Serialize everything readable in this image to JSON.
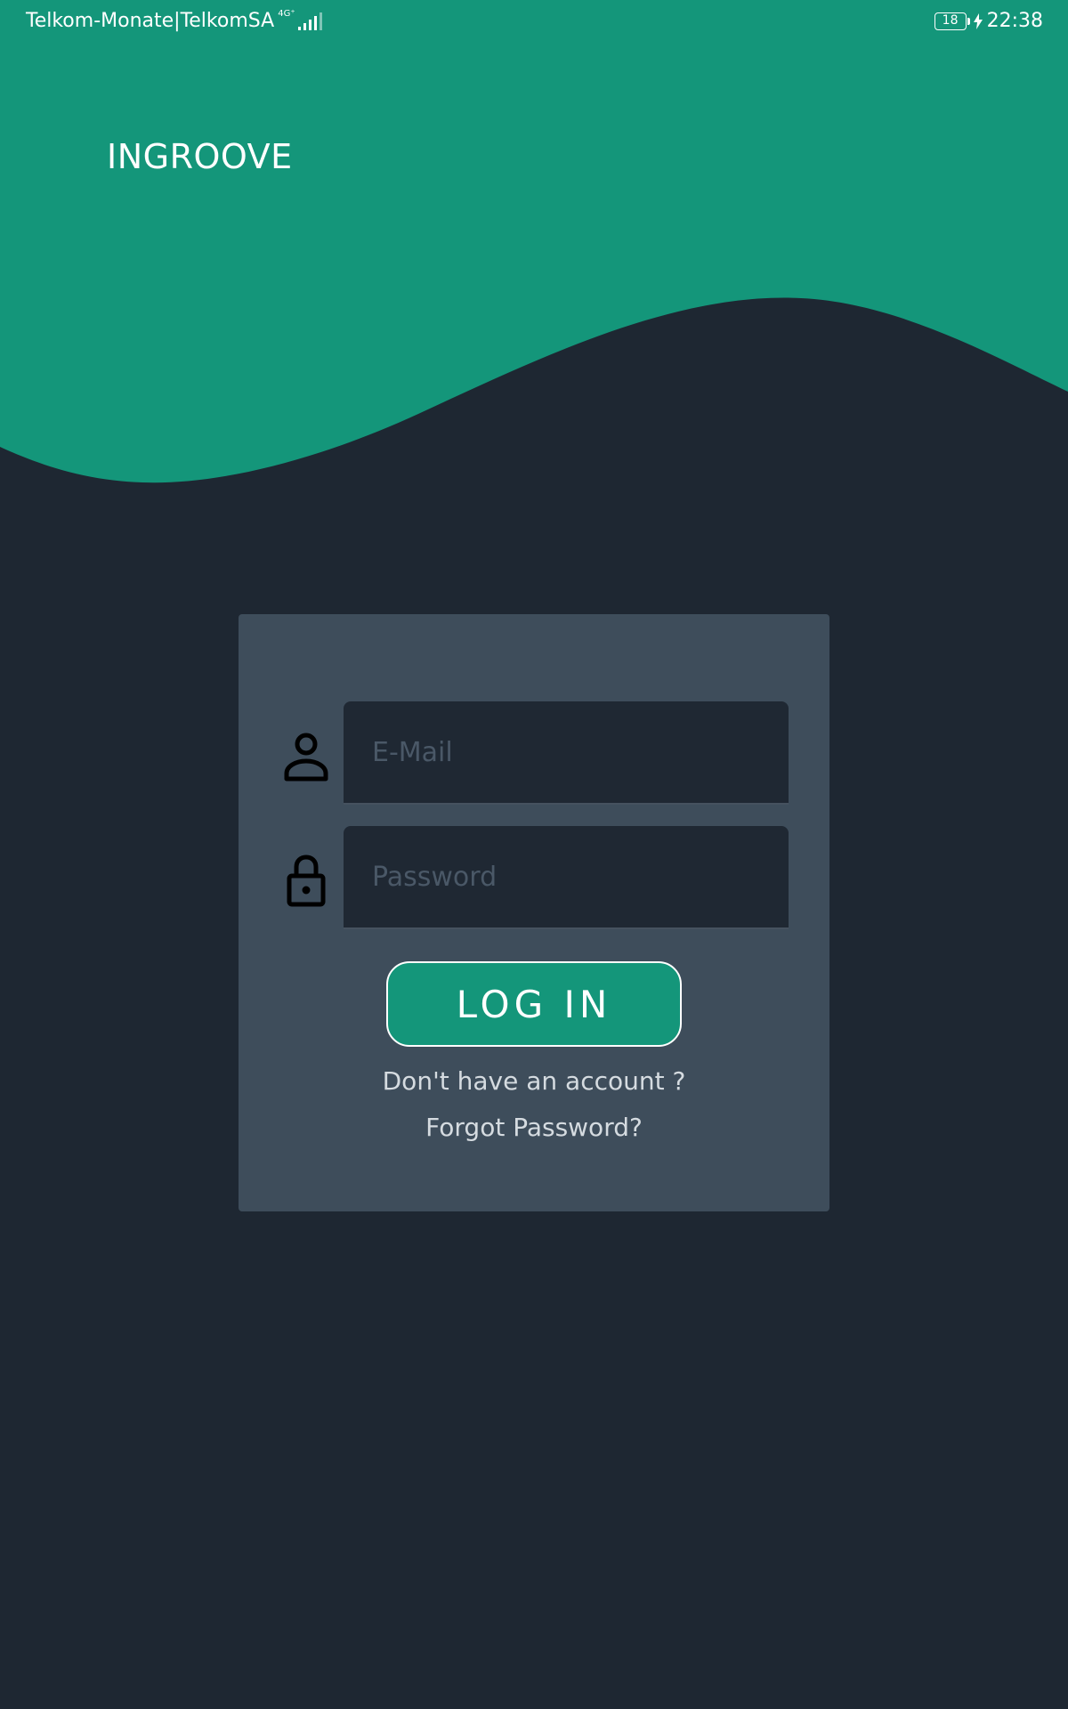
{
  "colors": {
    "primary": "#14967a",
    "background": "#1e2732",
    "card": "#3e4d5b",
    "input_background": "#1f2833",
    "placeholder": "#4a5867",
    "link_text": "#d5dbe0"
  },
  "status_bar": {
    "carrier": "Telkom-Monate|TelkomSA",
    "network_type": "4G⁺",
    "battery_level": "18",
    "time": "22:38",
    "icons": [
      "signal-icon",
      "battery-icon",
      "charging-bolt-icon"
    ]
  },
  "app": {
    "title": "INGROOVE"
  },
  "login_form": {
    "email": {
      "icon": "person-icon",
      "placeholder": "E-Mail",
      "value": ""
    },
    "password": {
      "icon": "lock-icon",
      "placeholder": "Password",
      "value": ""
    },
    "login_button_label": "LOG IN",
    "signup_link": "Don't have an account ?",
    "forgot_password_link": "Forgot Password?"
  }
}
